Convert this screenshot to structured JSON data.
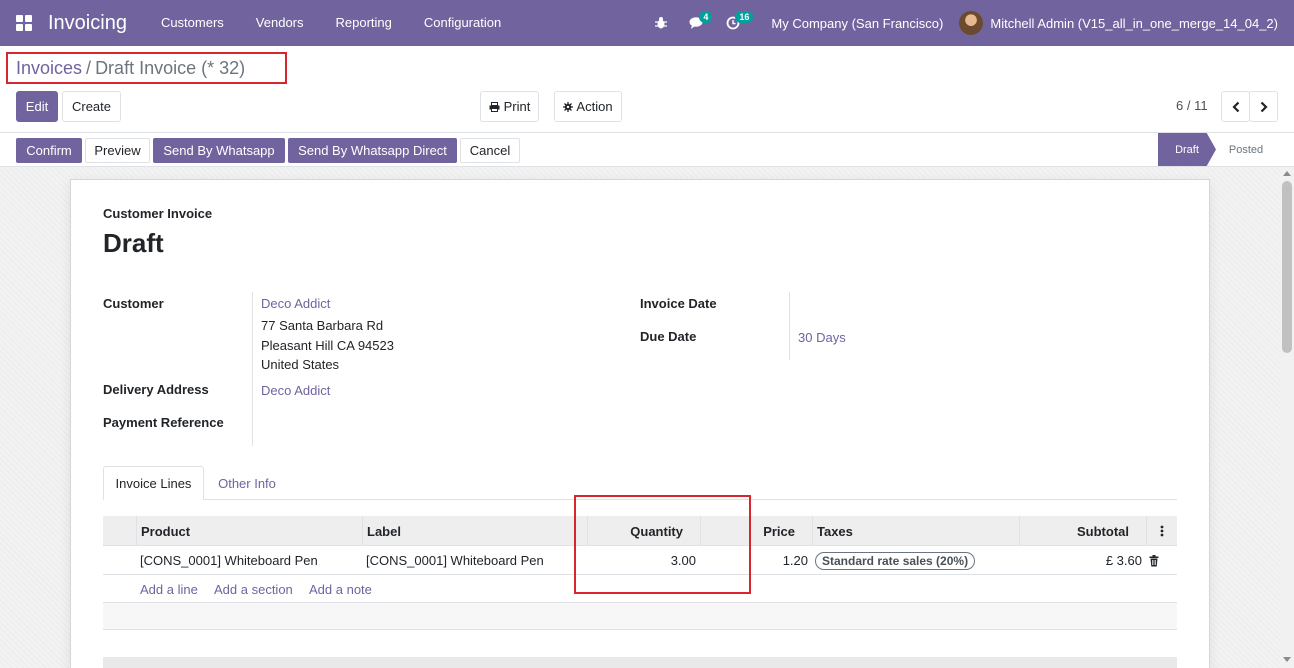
{
  "navbar": {
    "brand": "Invoicing",
    "menu": [
      "Customers",
      "Vendors",
      "Reporting",
      "Configuration"
    ],
    "messages_count": "4",
    "activities_count": "16",
    "company": "My Company (San Francisco)",
    "user": "Mitchell Admin (V15_all_in_one_merge_14_04_2)"
  },
  "breadcrumb": {
    "parent": "Invoices",
    "separator": "/",
    "current": "Draft Invoice (* 32)"
  },
  "control": {
    "edit": "Edit",
    "create": "Create",
    "print": "Print",
    "action": "Action",
    "pager": "6 / 11"
  },
  "statusbar": {
    "buttons": [
      "Confirm",
      "Preview",
      "Send By Whatsapp",
      "Send By Whatsapp Direct",
      "Cancel"
    ],
    "stages": [
      "Draft",
      "Posted"
    ],
    "active_stage": "Draft"
  },
  "form": {
    "doc_type": "Customer Invoice",
    "title": "Draft",
    "customer_label": "Customer",
    "customer_name": "Deco Addict",
    "address": [
      "77 Santa Barbara Rd",
      "Pleasant Hill CA 94523",
      "United States"
    ],
    "delivery_label": "Delivery Address",
    "delivery_value": "Deco Addict",
    "payment_ref_label": "Payment Reference",
    "invoice_date_label": "Invoice Date",
    "due_date_label": "Due Date",
    "due_date_value": "30 Days"
  },
  "tabs": [
    "Invoice Lines",
    "Other Info"
  ],
  "lines": {
    "headers": {
      "product": "Product",
      "label": "Label",
      "quantity": "Quantity",
      "price": "Price",
      "taxes": "Taxes",
      "subtotal": "Subtotal"
    },
    "rows": [
      {
        "product": "[CONS_0001] Whiteboard Pen",
        "label": "[CONS_0001] Whiteboard Pen",
        "quantity": "3.00",
        "price": "1.20",
        "tax": "Standard rate sales (20%)",
        "subtotal": "£ 3.60"
      }
    ],
    "add_line": "Add a line",
    "add_section": "Add a section",
    "add_note": "Add a note"
  }
}
